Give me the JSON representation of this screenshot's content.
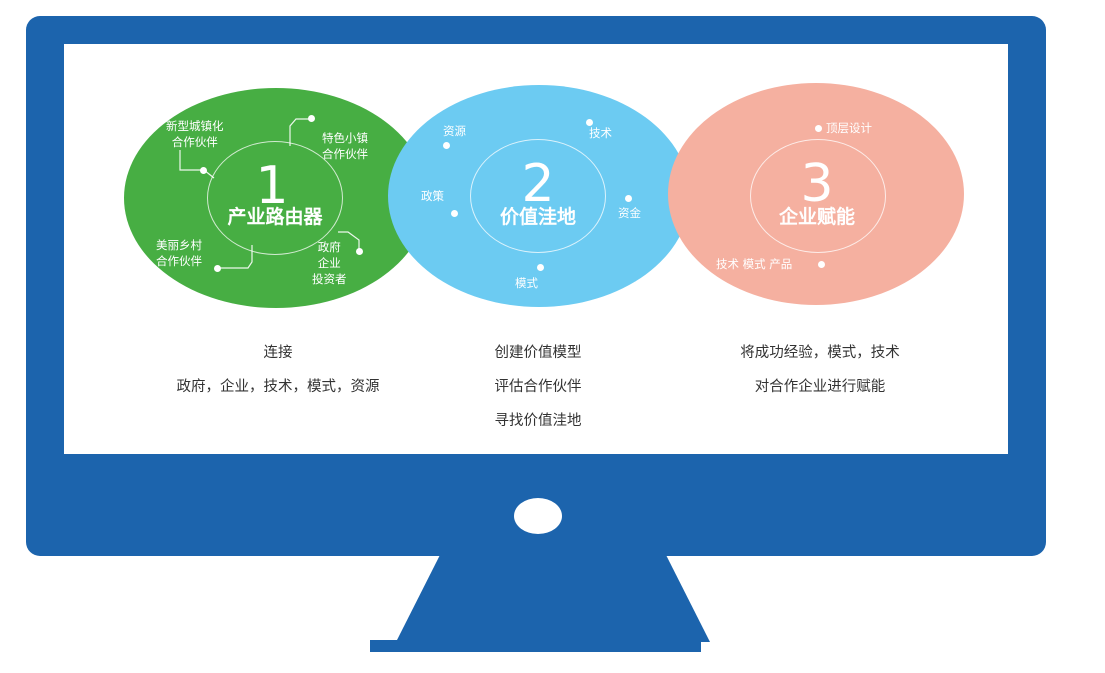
{
  "circles": [
    {
      "number": "1",
      "title": "产业路由器",
      "labels": {
        "top_left": [
          "新型城镇化",
          "合作伙伴"
        ],
        "top_right": [
          "特色小镇",
          "合作伙伴"
        ],
        "bottom_left": [
          "美丽乡村",
          "合作伙伴"
        ],
        "bottom_right": [
          "政府",
          "企业",
          "投资者"
        ]
      },
      "color": "#47ae43"
    },
    {
      "number": "2",
      "title": "价值洼地",
      "labels": {
        "top_left": "资源",
        "top_right": "技术",
        "left": "政策",
        "right": "资金",
        "bottom": "模式"
      },
      "color": "#6ccbf2"
    },
    {
      "number": "3",
      "title": "企业赋能",
      "labels": {
        "top_right": "顶层设计",
        "bottom_left": "技术 模式 产品"
      },
      "color": "#f5b0a0"
    }
  ],
  "descriptions": [
    [
      "连接",
      "政府，企业，技术，模式，资源"
    ],
    [
      "创建价值模型",
      "评估合作伙伴",
      "寻找价值洼地"
    ],
    [
      "将成功经验，模式，技术",
      "对合作企业进行赋能"
    ]
  ],
  "colors": {
    "monitor": "#1c64ad",
    "screen": "#ffffff",
    "text": "#333333"
  }
}
